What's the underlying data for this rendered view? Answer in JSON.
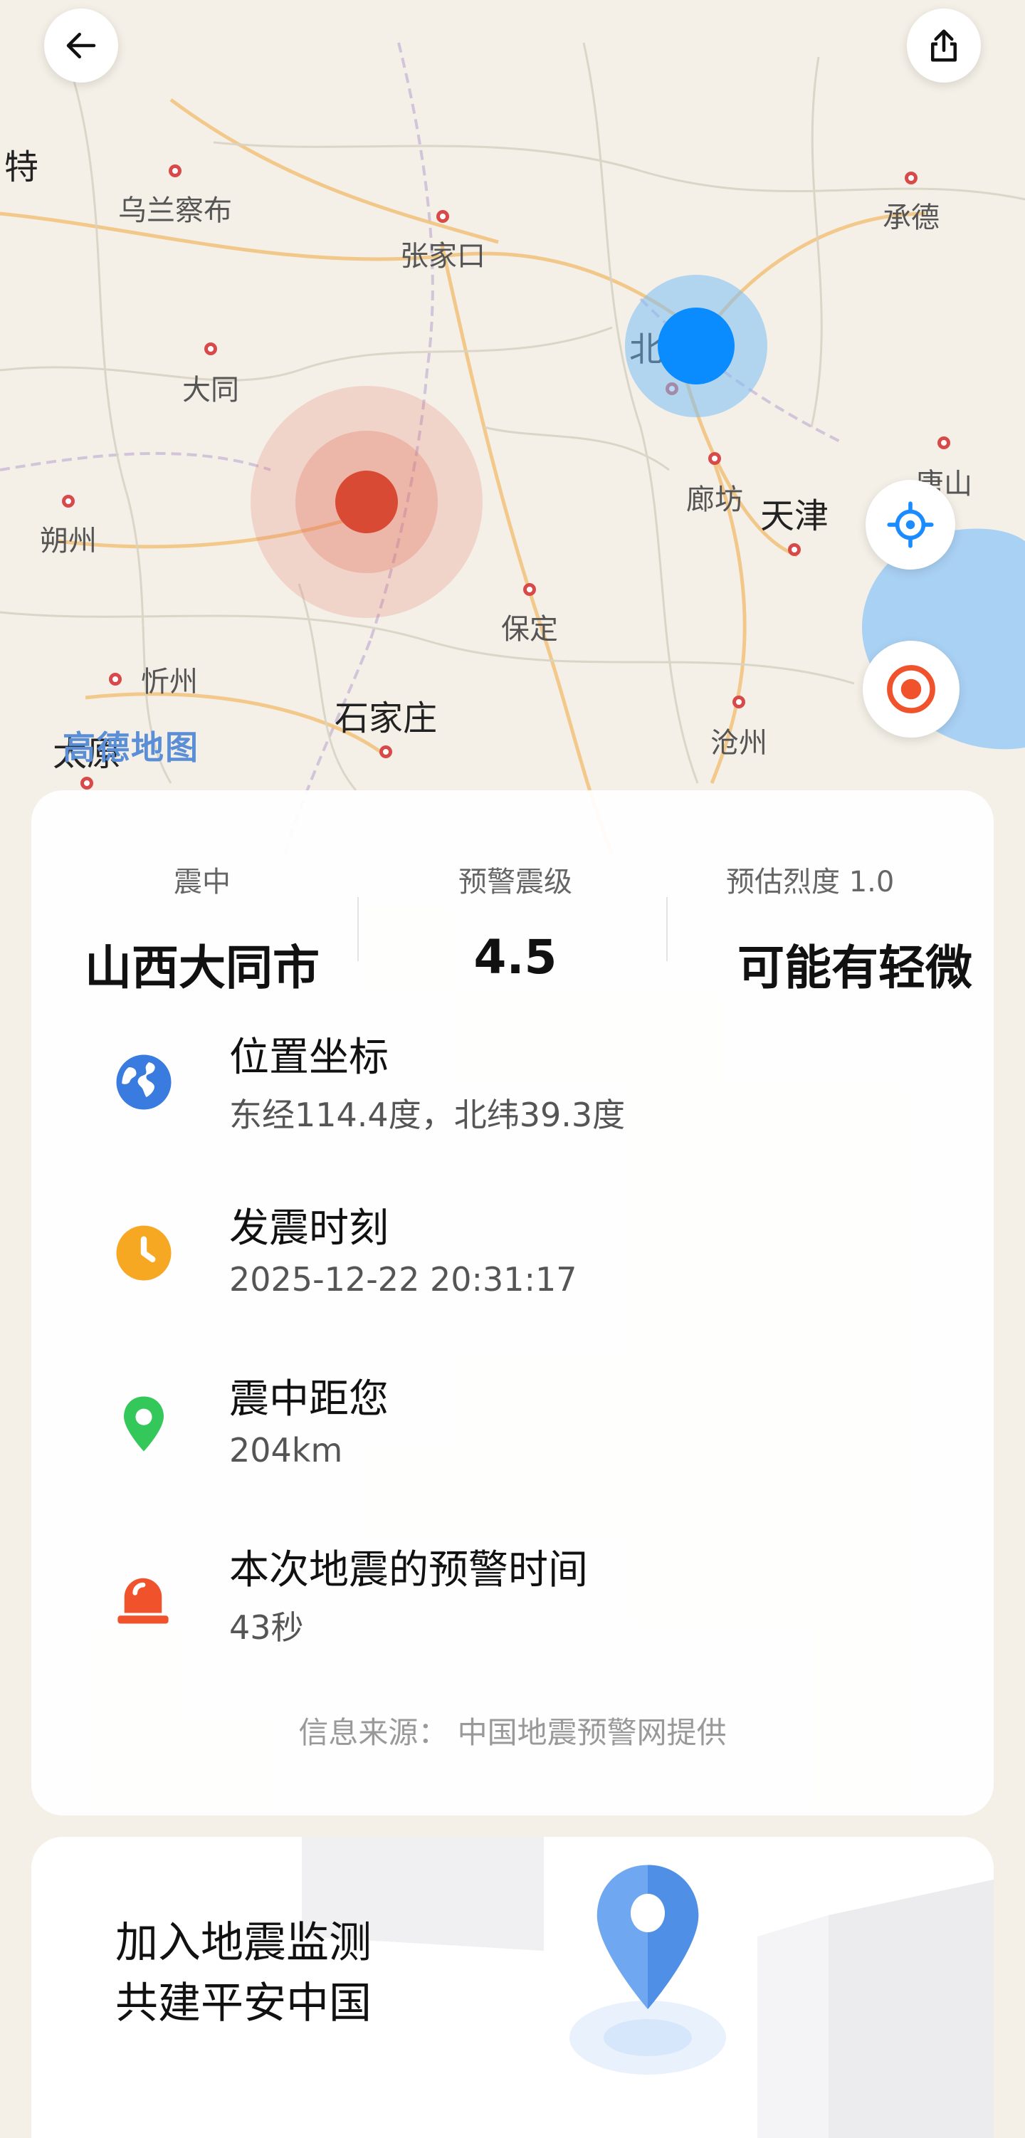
{
  "map": {
    "logo": "高德地图",
    "cities": [
      {
        "name": "特"
      },
      {
        "name": "乌兰察布"
      },
      {
        "name": "张家口"
      },
      {
        "name": "承德"
      },
      {
        "name": "北"
      },
      {
        "name": "大同"
      },
      {
        "name": "朔州"
      },
      {
        "name": "廊坊"
      },
      {
        "name": "天津"
      },
      {
        "name": "唐山"
      },
      {
        "name": "保定"
      },
      {
        "name": "忻州"
      },
      {
        "name": "石家庄"
      },
      {
        "name": "沧州"
      },
      {
        "name": "太原"
      }
    ]
  },
  "info": {
    "epicenter_label": "震中",
    "epicenter_value": "山西大同市",
    "magnitude_label": "预警震级",
    "magnitude_value": "4.5",
    "intensity_label": "预估烈度 1.0",
    "intensity_value": "可能有轻微",
    "rows": [
      {
        "icon": "globe-icon",
        "title": "位置坐标",
        "value": "东经114.4度，北纬39.3度"
      },
      {
        "icon": "clock-icon",
        "title": "发震时刻",
        "value": "2025-12-22 20:31:17"
      },
      {
        "icon": "location-pin-icon",
        "title": "震中距您",
        "value": "204km"
      },
      {
        "icon": "alarm-light-icon",
        "title": "本次地震的预警时间",
        "value": "43秒"
      }
    ],
    "source": "信息来源：  中国地震预警网提供"
  },
  "join": {
    "line1": "加入地震监测",
    "line2": "共建平安中国"
  },
  "colors": {
    "user_location": "#0a8cff",
    "epicenter": "#d84a33",
    "globe": "#3a7be0",
    "clock": "#f7a823",
    "pin": "#34c759",
    "alarm": "#f0522c"
  }
}
